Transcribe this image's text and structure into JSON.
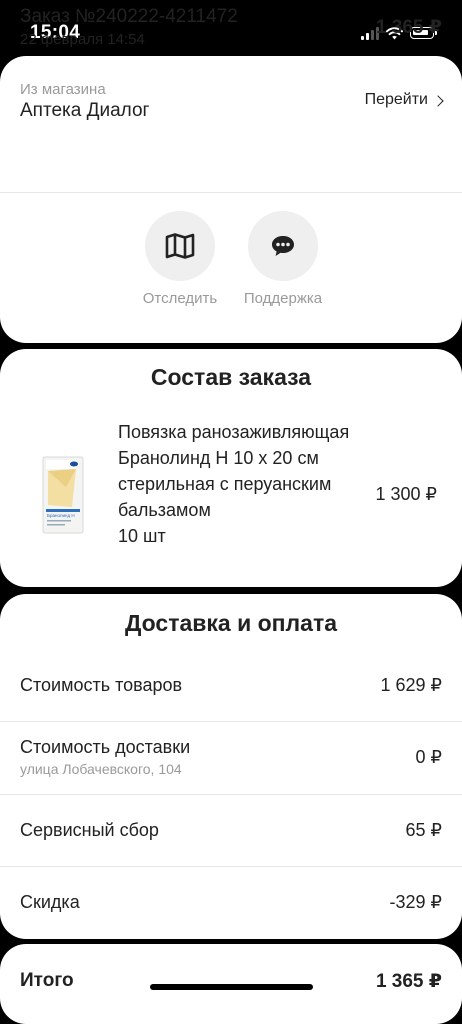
{
  "status_bar": {
    "time": "15:04"
  },
  "order": {
    "title": "Заказ №240222-4211472",
    "date": "22 февраля 14:54",
    "sum": "1 365 ₽"
  },
  "store": {
    "caption": "Из магазина",
    "name": "Аптека Диалог",
    "go_label": "Перейти"
  },
  "actions": {
    "track_label": "Отследить",
    "support_label": "Поддержка"
  },
  "items_section": {
    "title": "Состав заказа",
    "product": {
      "name": "Повязка ранозаживляющая Бранолинд Н 10 х 20 см стерильная с перуанским бальзамом",
      "quantity": "10 шт",
      "price": "1 300 ₽",
      "package_text": "Бранолинд Н"
    }
  },
  "delivery_section": {
    "title": "Доставка и оплата",
    "rows": [
      {
        "label": "Стоимость товаров",
        "value": "1 629 ₽"
      },
      {
        "label": "Стоимость доставки",
        "sub": "улица Лобачевского, 104",
        "value": "0 ₽"
      },
      {
        "label": "Сервисный сбор",
        "value": "65 ₽"
      },
      {
        "label": "Скидка",
        "value": "-329 ₽"
      }
    ]
  },
  "total": {
    "label": "Итого",
    "value": "1 365 ₽"
  },
  "colors": {
    "background": "#000000",
    "card": "#ffffff",
    "muted_text": "#9a9a9a",
    "action_circle": "#efefef"
  }
}
